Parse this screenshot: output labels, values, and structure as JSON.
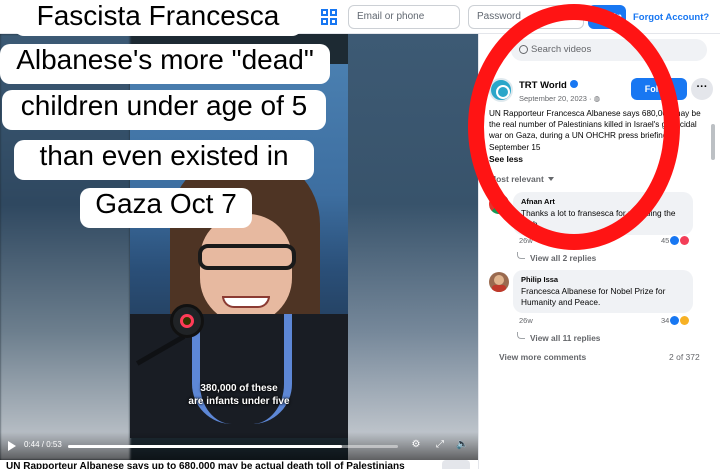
{
  "topbar": {
    "email_placeholder": "Email or phone",
    "password_placeholder": "Password",
    "login_label": "Log In",
    "forgot_label": "Forgot Account?"
  },
  "meme_caption": {
    "lines": [
      "Fascista Francesca",
      "Albanese's more \"dead\"",
      "children under age of 5",
      "than even existed in",
      "Gaza Oct 7"
    ]
  },
  "video": {
    "subtitle_line1": "380,000 of these",
    "subtitle_line2": "are infants under five",
    "time": "0:44 / 0:53",
    "progress": 0.83,
    "bottom_title": "UN Rapporteur Albanese says up to 680,000 may be actual death toll of Palestinians"
  },
  "panel": {
    "search_placeholder": "Search videos",
    "post": {
      "page_name": "TRT World",
      "date": "September 20, 2023 · ",
      "follow_label": "Follow",
      "more_label": "···",
      "text": "UN Rapporteur Francesca Albanese says 680,000 may be the real number of Palestinians killed in Israel's genocidal war on Gaza, during a UN OHCHR press briefing on September 15",
      "see_less": "See less"
    },
    "sort_label": "Most relevant",
    "comments": [
      {
        "name": "Afnan Art",
        "text": "Thanks a lot to fransesca for revealing the truth",
        "time": "26w",
        "reactions": "45",
        "replies": "View all 2 replies"
      },
      {
        "name": "Philip Issa",
        "text": "Francesca Albanese for Nobel Prize for Humanity and Peace.",
        "time": "26w",
        "reactions": "34",
        "replies": "View all 11 replies"
      }
    ],
    "view_more": "View more comments",
    "counter": "2 of 372"
  },
  "colors": {
    "brand_blue": "#1877f2",
    "highlight_red": "#ff1414"
  }
}
